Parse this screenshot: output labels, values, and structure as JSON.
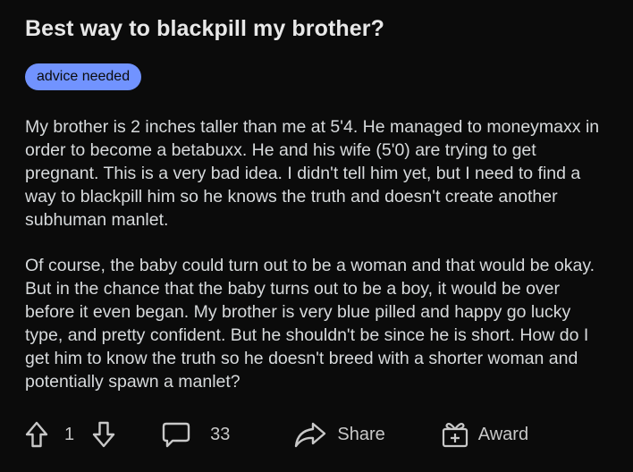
{
  "post": {
    "title": "Best way to blackpill my brother?",
    "flair": "advice needed",
    "paragraphs": [
      "My brother is 2 inches taller than me at 5'4. He managed to moneymaxx in order to become a betabuxx. He and his wife (5'0) are trying to get pregnant. This is a very bad idea. I didn't tell him yet, but I need to find a way to blackpill him so he knows the truth and doesn't create another subhuman manlet.",
      "Of course, the baby could turn out to be a woman and that would be okay. But in the chance that the baby turns out to be a boy, it would be over before it even began. My brother is very blue pilled and happy go lucky type, and pretty confident. But he shouldn't be since he is short. How do I get him to know the truth so he doesn't breed with a shorter woman and potentially spawn a manlet?"
    ]
  },
  "actions": {
    "vote_count": "1",
    "comment_count": "33",
    "share_label": "Share",
    "award_label": "Award"
  },
  "colors": {
    "background": "#0b0b0b",
    "text": "#d7dadc",
    "flair_bg": "#7193ff"
  },
  "icons": [
    "upvote-icon",
    "downvote-icon",
    "comment-icon",
    "share-icon",
    "award-icon"
  ]
}
